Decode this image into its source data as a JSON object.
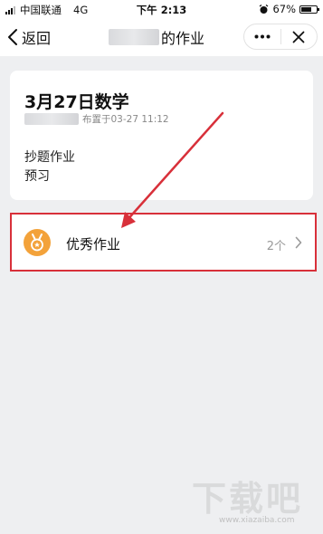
{
  "status_bar": {
    "carrier": "中国联通",
    "network": "4G",
    "time": "下午 2:13",
    "battery_percent": "67%",
    "battery_level": 0.67
  },
  "nav": {
    "back_label": "返回",
    "title_suffix": "的作业",
    "more_icon": "more-dots-icon",
    "close_icon": "close-icon"
  },
  "homework": {
    "title": "3月27日数学",
    "assigned": "布置于03-27 11:12",
    "items": [
      "抄题作业",
      "预习"
    ]
  },
  "excellent": {
    "label": "优秀作业",
    "count": "2个",
    "icon": "medal-icon",
    "icon_color": "#f3a23a",
    "highlight_color": "#d8303a"
  },
  "watermark": {
    "text": "下载吧",
    "url": "www.xiazaiba.com"
  }
}
